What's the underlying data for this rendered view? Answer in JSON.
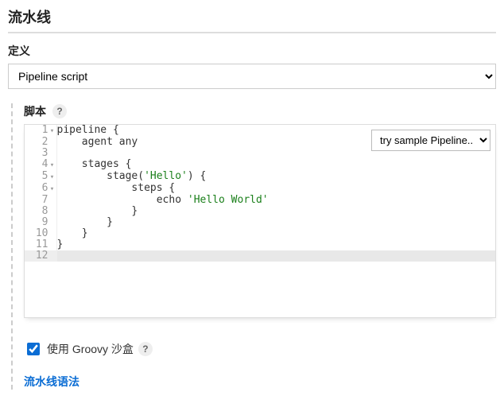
{
  "header": {
    "title": "流水线"
  },
  "definition": {
    "label": "定义",
    "selected": "Pipeline script"
  },
  "script": {
    "label": "脚本",
    "help": "?",
    "sample_placeholder": "try sample Pipeline...",
    "lines": [
      {
        "n": 1,
        "fold": true,
        "text": "pipeline {"
      },
      {
        "n": 2,
        "fold": false,
        "text": "    agent any"
      },
      {
        "n": 3,
        "fold": false,
        "text": ""
      },
      {
        "n": 4,
        "fold": true,
        "text": "    stages {"
      },
      {
        "n": 5,
        "fold": true,
        "text": "        stage('Hello') {",
        "string": "'Hello'"
      },
      {
        "n": 6,
        "fold": true,
        "text": "            steps {"
      },
      {
        "n": 7,
        "fold": false,
        "text": "                echo 'Hello World'",
        "string": "'Hello World'"
      },
      {
        "n": 8,
        "fold": false,
        "text": "            }"
      },
      {
        "n": 9,
        "fold": false,
        "text": "        }"
      },
      {
        "n": 10,
        "fold": false,
        "text": "    }"
      },
      {
        "n": 11,
        "fold": false,
        "text": "}"
      },
      {
        "n": 12,
        "fold": false,
        "text": "",
        "active": true
      }
    ]
  },
  "sandbox": {
    "checked": true,
    "label": "使用 Groovy 沙盒",
    "help": "?"
  },
  "syntax_link": {
    "label": "流水线语法"
  }
}
